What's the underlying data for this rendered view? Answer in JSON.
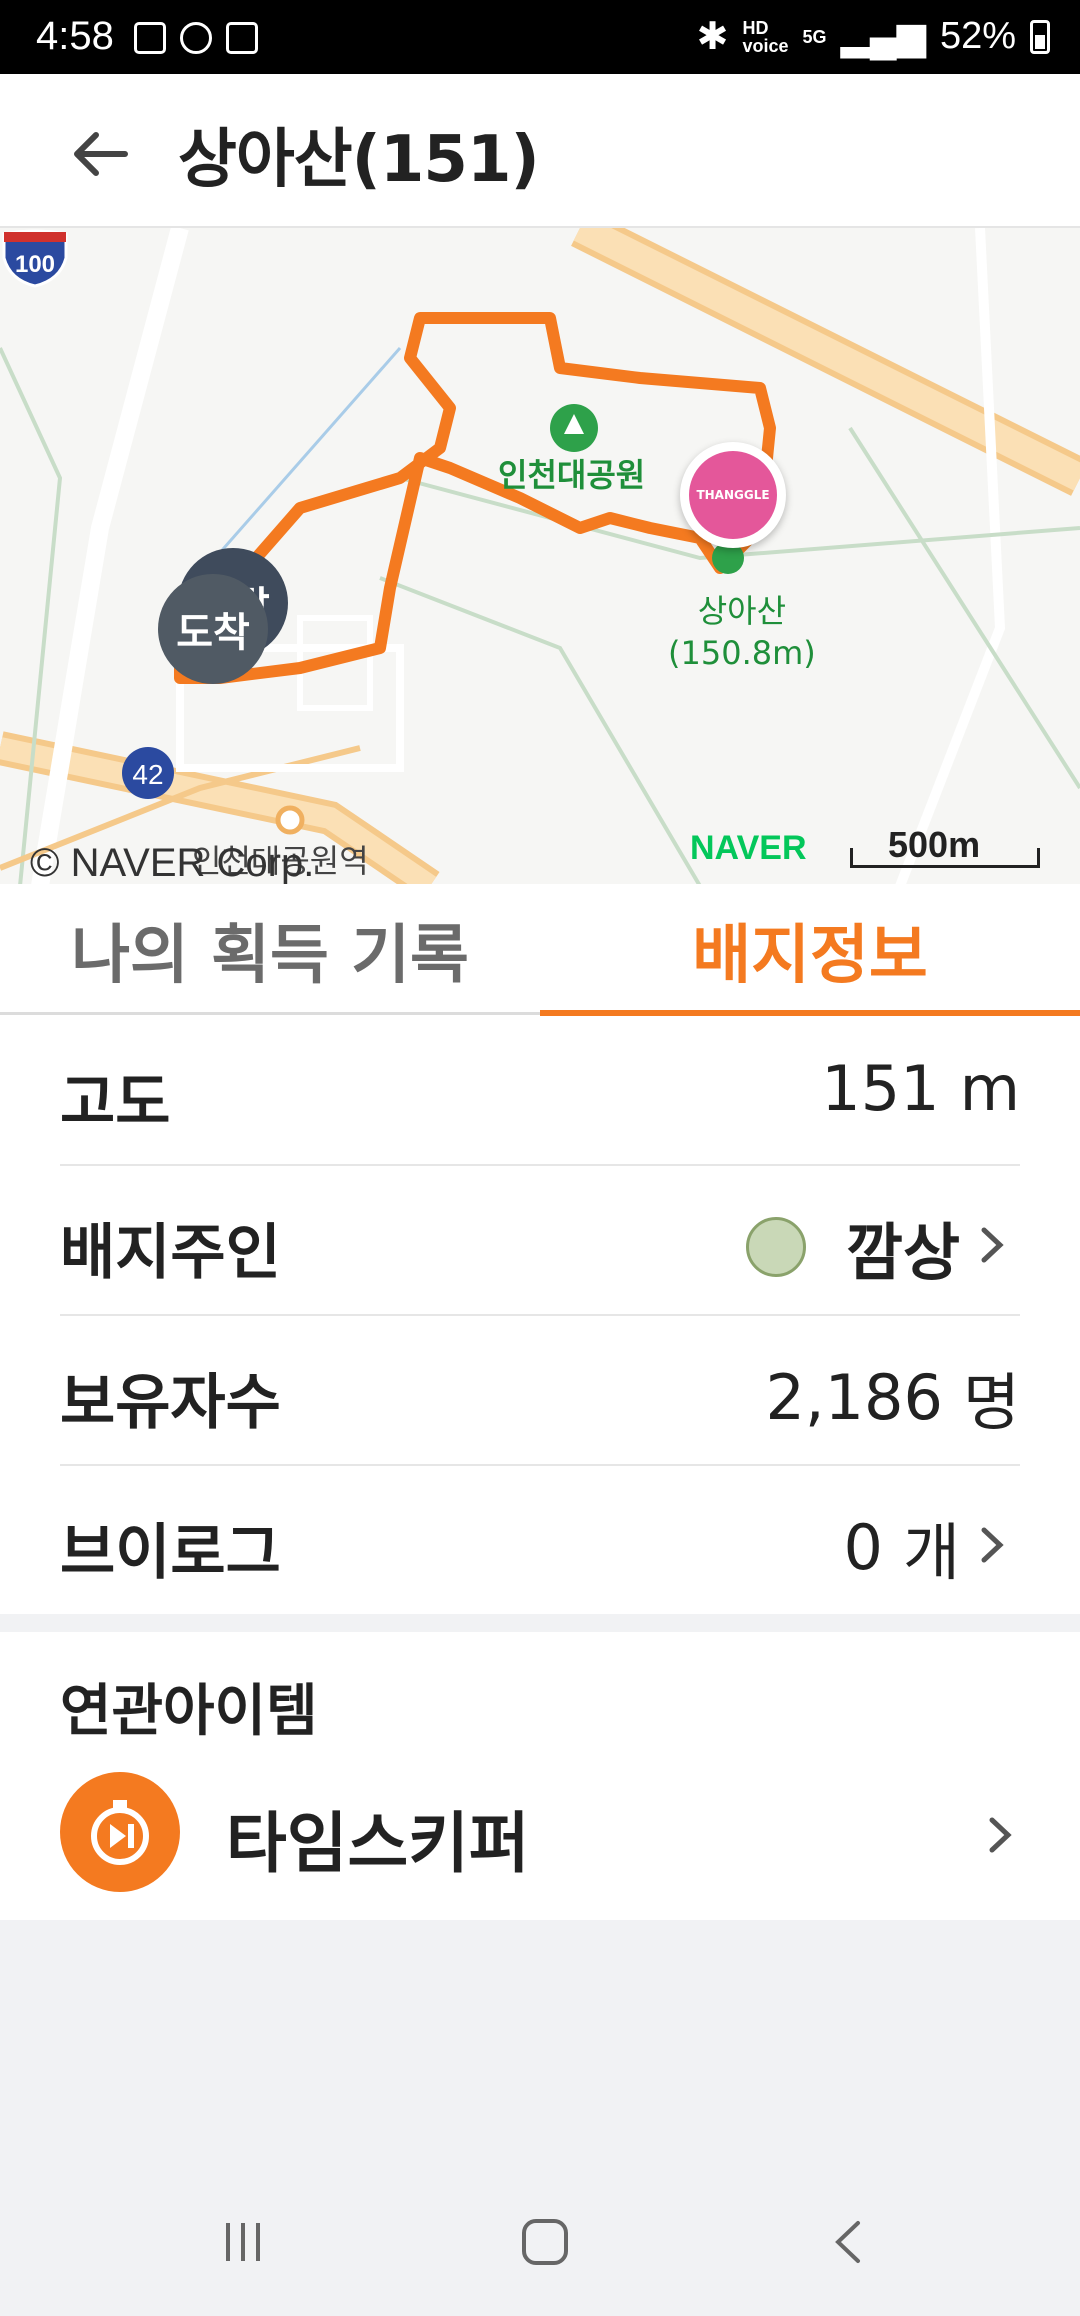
{
  "status_bar": {
    "time": "4:58",
    "network": "HD",
    "network_sub": "voice",
    "signal": "5G",
    "battery": "52%"
  },
  "header": {
    "title": "상아산(151)",
    "back_icon": "arrow-left-icon"
  },
  "map": {
    "park_label": "인천대공원",
    "peak_name": "상아산",
    "peak_height": "(150.8m)",
    "start_marker": "출발",
    "end_marker": "도착",
    "station_label": "인천대공원역",
    "copyright": "© NAVER Corp.",
    "provider": "NAVER",
    "scale": "500m",
    "road_shield": "100",
    "road_number": "42",
    "badge_text": "THANGGLE",
    "route_color": "#f47a20"
  },
  "tabs": {
    "items": [
      "나의 획득 기록",
      "배지정보"
    ],
    "active": "배지정보",
    "accent": "#f47a20"
  },
  "info": {
    "altitude": {
      "label": "고도",
      "value": "151",
      "unit": "m"
    },
    "owner": {
      "label": "배지주인",
      "value": "깜상"
    },
    "holders": {
      "label": "보유자수",
      "value": "2,186",
      "unit": "명"
    },
    "blog": {
      "label": "브이로그",
      "value": "0",
      "unit": "개"
    }
  },
  "related": {
    "title": "연관아이템",
    "item_name": "타임스키퍼",
    "item_icon": "time-skip-icon"
  },
  "navbar": {
    "recent": "recent-apps-icon",
    "home": "home-icon",
    "back": "back-icon"
  }
}
